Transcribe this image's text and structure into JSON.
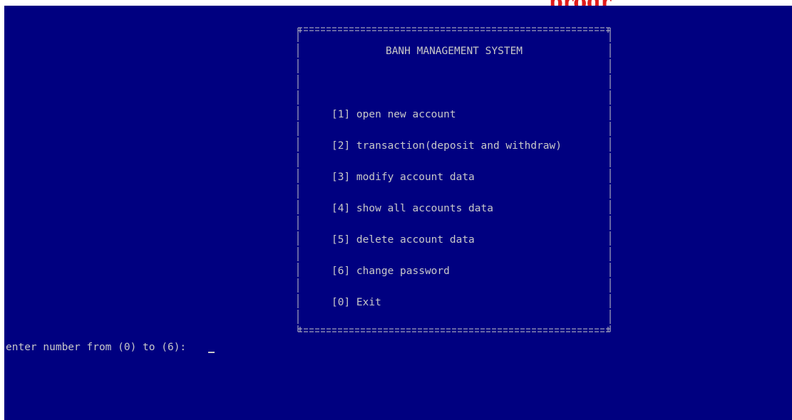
{
  "banner": {
    "text": "progr"
  },
  "menu": {
    "title": "BANH MANAGEMENT SYSTEM",
    "items": [
      {
        "label": "[1] open new account"
      },
      {
        "label": "[2] transaction(deposit and withdraw)"
      },
      {
        "label": "[3] modify account data"
      },
      {
        "label": "[4] show all accounts data"
      },
      {
        "label": "[5] delete account data"
      },
      {
        "label": "[6] change password"
      },
      {
        "label": "[0] Exit"
      }
    ]
  },
  "prompt": {
    "text": "enter number from (0) to (6):"
  },
  "colors": {
    "console_background": "#000080",
    "console_text": "#c8c8c8",
    "banner_text": "#e01b1b"
  }
}
